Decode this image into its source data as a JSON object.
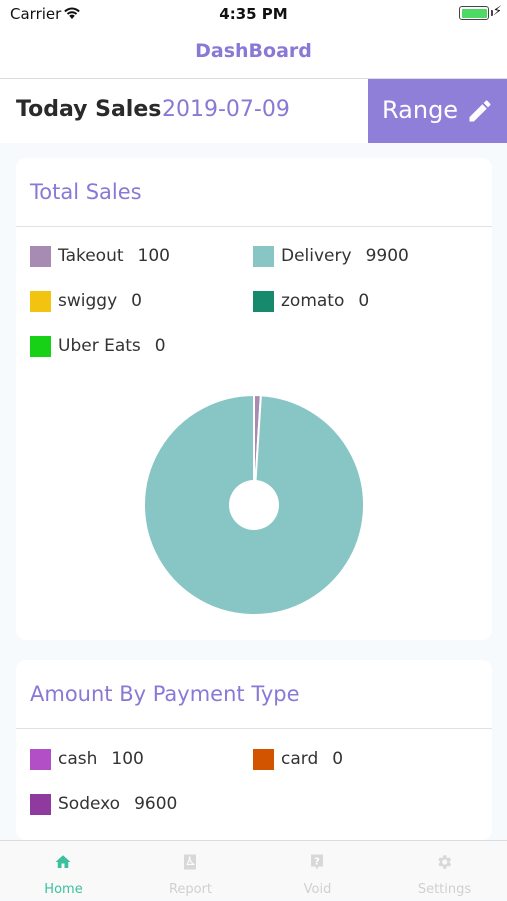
{
  "status": {
    "carrier": "Carrier",
    "time": "4:35 PM"
  },
  "nav": {
    "title": "DashBoard"
  },
  "today": {
    "label": "Today Sales",
    "date": "2019-07-09",
    "range_label": "Range"
  },
  "total_sales": {
    "title": "Total Sales",
    "legend": [
      {
        "name": "Takeout",
        "value": "100",
        "color": "#a88bb3"
      },
      {
        "name": "Delivery",
        "value": "9900",
        "color": "#88c6c6"
      },
      {
        "name": "swiggy",
        "value": "0",
        "color": "#f2c40f"
      },
      {
        "name": "zomato",
        "value": "0",
        "color": "#17896c"
      },
      {
        "name": "Uber Eats",
        "value": "0",
        "color": "#16d116"
      }
    ]
  },
  "chart_data": {
    "type": "pie",
    "categories": [
      "Takeout",
      "Delivery",
      "swiggy",
      "zomato",
      "Uber Eats"
    ],
    "values": [
      100,
      9900,
      0,
      0,
      0
    ],
    "colors": [
      "#a88bb3",
      "#88c6c6",
      "#f2c40f",
      "#17896c",
      "#16d116"
    ],
    "donut": true
  },
  "payment": {
    "title": "Amount By Payment Type",
    "legend": [
      {
        "name": "cash",
        "value": "100",
        "color": "#b24fc6"
      },
      {
        "name": "card",
        "value": "0",
        "color": "#d35400"
      },
      {
        "name": "Sodexo",
        "value": "9600",
        "color": "#8e3a9e"
      }
    ]
  },
  "tabs": [
    {
      "label": "Home",
      "icon": "home-icon",
      "active": true
    },
    {
      "label": "Report",
      "icon": "pdf-icon",
      "active": false
    },
    {
      "label": "Void",
      "icon": "question-icon",
      "active": false
    },
    {
      "label": "Settings",
      "icon": "gear-icon",
      "active": false
    }
  ],
  "colors": {
    "accent": "#8a78d6",
    "tab_active": "#3cc0a0",
    "tab_inactive": "#d8d8d8"
  }
}
